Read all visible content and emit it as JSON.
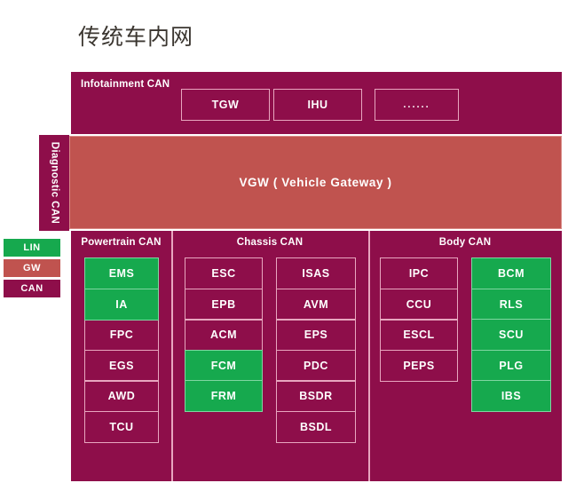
{
  "title": "传统车内网",
  "colors": {
    "can": "#8e0e4a",
    "gateway": "#c0534f",
    "lin": "#16a94e",
    "border": "#e8a6bf",
    "text": "#ffffff",
    "page_background": "#ffffff",
    "title_text": "#3b3630"
  },
  "legend": {
    "items": [
      {
        "label": "LIN",
        "color": "#16a94e"
      },
      {
        "label": "GW",
        "color": "#c0534f"
      },
      {
        "label": "CAN",
        "color": "#8e0e4a"
      }
    ]
  },
  "infotainment": {
    "title": "Infotainment CAN",
    "nodes": [
      {
        "label": "TGW",
        "type": "can"
      },
      {
        "label": "IHU",
        "type": "can"
      },
      {
        "label": "......",
        "type": "can"
      }
    ]
  },
  "diagnostic": {
    "label": "Diagnostic CAN"
  },
  "gateway": {
    "label": "VGW ( Vehicle  Gateway )"
  },
  "buses": [
    {
      "title": "Powertrain CAN",
      "columns": [
        {
          "nodes": [
            {
              "label": "EMS",
              "type": "lin"
            },
            {
              "label": "IA",
              "type": "lin"
            },
            {
              "label": "FPC",
              "type": "can"
            },
            {
              "label": "EGS",
              "type": "can"
            },
            {
              "label": "AWD",
              "type": "can"
            },
            {
              "label": "TCU",
              "type": "can"
            }
          ]
        }
      ]
    },
    {
      "title": "Chassis CAN",
      "columns": [
        {
          "nodes": [
            {
              "label": "ESC",
              "type": "can"
            },
            {
              "label": "EPB",
              "type": "can"
            },
            {
              "label": "ACM",
              "type": "can"
            },
            {
              "label": "FCM",
              "type": "lin"
            },
            {
              "label": "FRM",
              "type": "lin"
            }
          ]
        },
        {
          "nodes": [
            {
              "label": "ISAS",
              "type": "can"
            },
            {
              "label": "AVM",
              "type": "can"
            },
            {
              "label": "EPS",
              "type": "can"
            },
            {
              "label": "PDC",
              "type": "can"
            },
            {
              "label": "BSDR",
              "type": "can"
            },
            {
              "label": "BSDL",
              "type": "can"
            }
          ]
        }
      ]
    },
    {
      "title": "Body CAN",
      "columns": [
        {
          "nodes": [
            {
              "label": "IPC",
              "type": "can"
            },
            {
              "label": "CCU",
              "type": "can"
            },
            {
              "label": "ESCL",
              "type": "can"
            },
            {
              "label": "PEPS",
              "type": "can"
            }
          ]
        },
        {
          "nodes": [
            {
              "label": "BCM",
              "type": "lin"
            },
            {
              "label": "RLS",
              "type": "lin"
            },
            {
              "label": "SCU",
              "type": "lin"
            },
            {
              "label": "PLG",
              "type": "lin"
            },
            {
              "label": "IBS",
              "type": "lin"
            }
          ]
        }
      ]
    }
  ]
}
